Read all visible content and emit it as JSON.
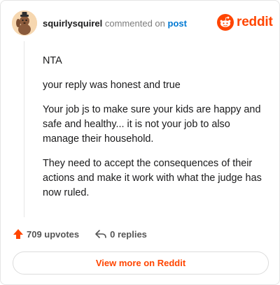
{
  "header": {
    "username": "squirlysquirel",
    "action_text": "commented on",
    "target_link": "post",
    "brand": "reddit"
  },
  "comment": {
    "paragraphs": [
      "NTA",
      "your reply was honest and true",
      "Your job js to make sure your kids are happy and safe and healthy... it is not your job to also manage their household.",
      "They need to accept the consequences of their actions and make it work with what the judge has now ruled."
    ]
  },
  "actions": {
    "upvotes_label": "709 upvotes",
    "replies_label": "0 replies"
  },
  "footer": {
    "view_more_label": "View more on Reddit"
  },
  "colors": {
    "brand": "#ff4500",
    "link": "#0079d3"
  },
  "icons": {
    "upvote": "upvote-arrow-icon",
    "reply": "reply-arrow-icon",
    "brand": "reddit-snoo-icon"
  }
}
